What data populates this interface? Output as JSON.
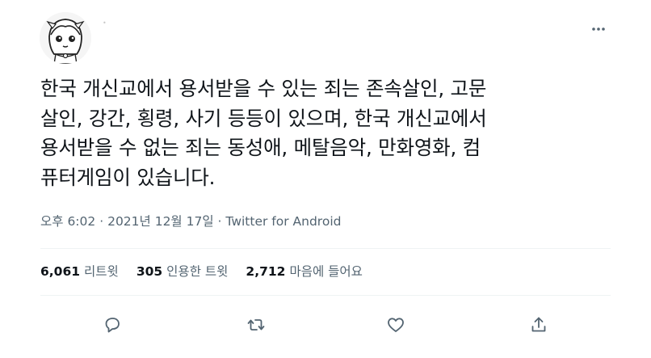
{
  "tweet": {
    "text_lines": [
      "한국 개신교에서 용서받을 수 있는 죄는 존속살인, 고문",
      "살인, 강간, 횡령, 사기 등등이 있으며, 한국 개신교에서",
      "용서받을 수 없는 죄는 동성애, 메탈음악, 만화영화, 컴",
      "퓨터게임이 있습니다."
    ],
    "time": "오후 6:02",
    "separator": "·",
    "date": "2021년 12월 17일",
    "source": "Twitter for Android"
  },
  "stats": {
    "retweets_count": "6,061",
    "retweets_label": "리트윗",
    "quotes_count": "305",
    "quotes_label": "인용한 트윗",
    "likes_count": "2,712",
    "likes_label": "마음에 들어요"
  },
  "icons": {
    "more": "more-options-icon",
    "reply": "reply-icon",
    "retweet": "retweet-icon",
    "like": "like-icon",
    "share": "share-icon"
  },
  "colors": {
    "text": "#0f1419",
    "muted": "#536471",
    "divider": "#eff3f4"
  }
}
